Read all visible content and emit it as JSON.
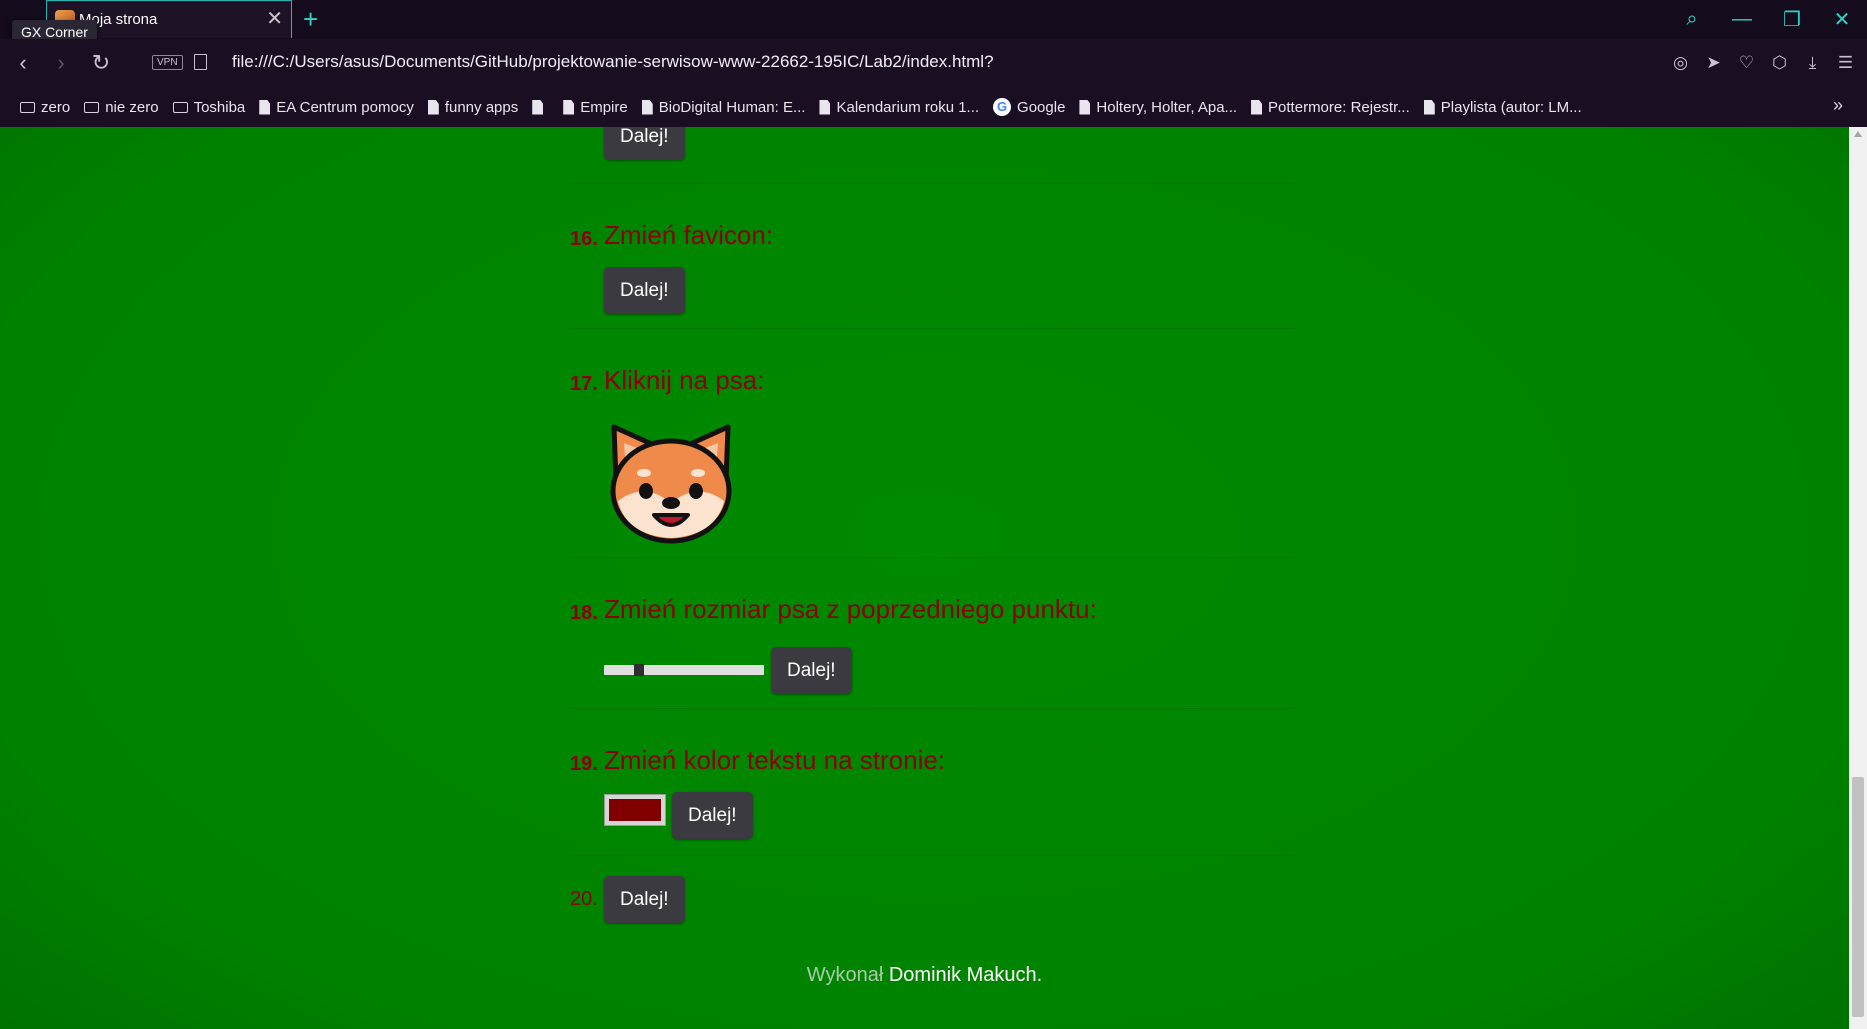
{
  "browser": {
    "tab_title": "Moja strona",
    "tooltip": "GX Corner",
    "vpn_label": "VPN",
    "url": "file:///C:/Users/asus/Documents/GitHub/projektowanie-serwisow-www-22662-195IC/Lab2/index.html?",
    "bookmarks": [
      {
        "label": "zero",
        "icon": "folder-icon"
      },
      {
        "label": "nie zero",
        "icon": "folder-icon"
      },
      {
        "label": "Toshiba",
        "icon": "folder-icon"
      },
      {
        "label": "EA Centrum pomocy",
        "icon": "page-icon"
      },
      {
        "label": "funny apps",
        "icon": "page-icon"
      },
      {
        "label": "",
        "icon": "page-icon"
      },
      {
        "label": "Empire",
        "icon": "page-icon"
      },
      {
        "label": "BioDigital Human: E...",
        "icon": "page-icon"
      },
      {
        "label": "Kalendarium roku 1...",
        "icon": "page-icon"
      },
      {
        "label": "Google",
        "icon": "google-icon"
      },
      {
        "label": "Holtery, Holter, Apa...",
        "icon": "page-icon"
      },
      {
        "label": "Pottermore: Rejestr...",
        "icon": "page-icon"
      },
      {
        "label": "Playlista (autor: LM...",
        "icon": "page-icon"
      }
    ]
  },
  "page": {
    "top_button": "Dalej!",
    "steps": [
      {
        "num": "16.",
        "title": "Zmień favicon:",
        "button": "Dalej!"
      },
      {
        "num": "17.",
        "title": "Kliknij na psa:"
      },
      {
        "num": "18.",
        "title": "Zmień rozmiar psa z poprzedniego punktu:",
        "button": "Dalej!",
        "slider_value": 0.2
      },
      {
        "num": "19.",
        "title": "Zmień kolor tekstu na stronie:",
        "button": "Dalej!",
        "color_value": "#800000"
      },
      {
        "num": "20.",
        "button": "Dalej!"
      }
    ],
    "footer_prefix": "Wykonał",
    "footer_author": "Dominik Makuch",
    "footer_suffix": "."
  },
  "colors": {
    "accent": "#2fd3c6",
    "step_text": "#8b0000",
    "page_bg": "#008000",
    "button_bg": "#3b3a40"
  }
}
